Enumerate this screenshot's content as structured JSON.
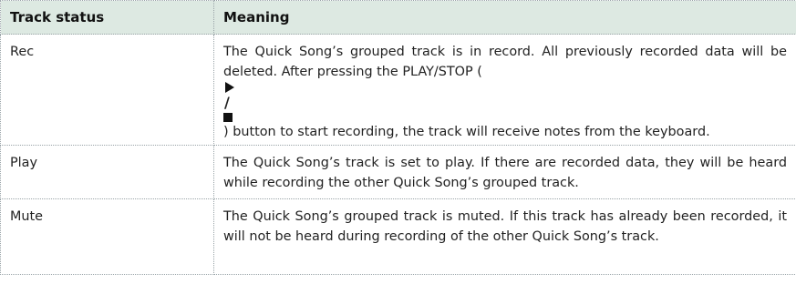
{
  "table": {
    "headers": {
      "status": "Track status",
      "meaning": "Meaning"
    },
    "rows": [
      {
        "status": "Rec",
        "meaning_before_icons": "The Quick Song’s grouped track is in record. All previously recorded data will be deleted. After pressing the PLAY/STOP (",
        "meaning_after_icons": ") button to start recording, the track will receive notes from the keyboard.",
        "icons": [
          "play-icon",
          "stop-icon"
        ]
      },
      {
        "status": "Play",
        "meaning": "The Quick Song’s track is set to play. If there are recorded data, they will be heard while recording the other Quick Song’s grouped track."
      },
      {
        "status": "Mute",
        "meaning": "The Quick Song’s grouped track is muted. If this track has already been recorded, it will not be heard during recording of the other Quick Song’s track."
      }
    ]
  }
}
